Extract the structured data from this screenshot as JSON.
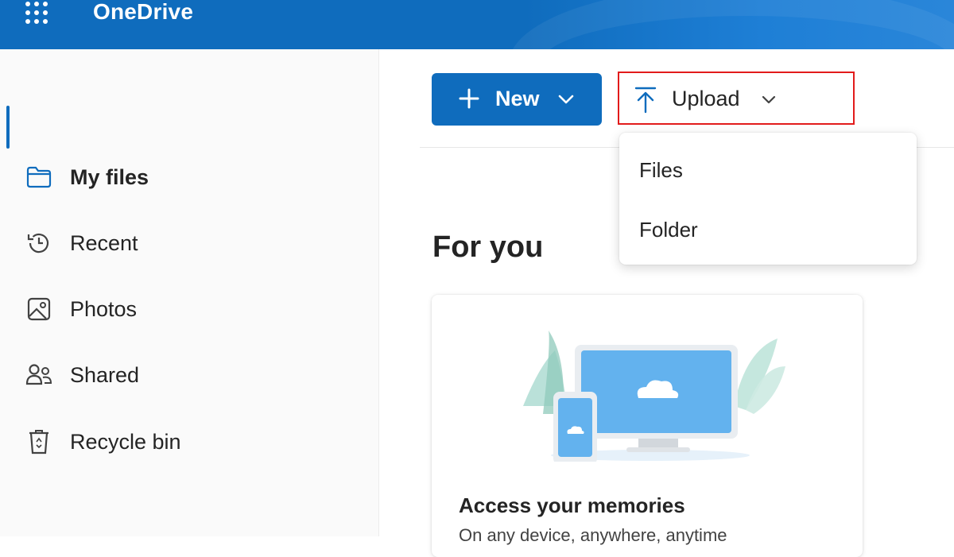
{
  "header": {
    "app_title": "OneDrive",
    "accent": "#0f6cbd"
  },
  "sidebar": {
    "items": [
      {
        "label": "My files",
        "icon": "folder-icon",
        "active": true
      },
      {
        "label": "Recent",
        "icon": "history-icon"
      },
      {
        "label": "Photos",
        "icon": "photo-icon"
      },
      {
        "label": "Shared",
        "icon": "people-icon"
      },
      {
        "label": "Recycle bin",
        "icon": "recycle-bin-icon"
      }
    ]
  },
  "toolbar": {
    "new_label": "New",
    "upload_label": "Upload",
    "highlight_color": "#e21b1b"
  },
  "upload_menu": {
    "items": [
      "Files",
      "Folder"
    ]
  },
  "main": {
    "section_title": "For you",
    "card": {
      "title": "Access your memories",
      "subtitle": "On any device, anywhere, anytime"
    }
  }
}
